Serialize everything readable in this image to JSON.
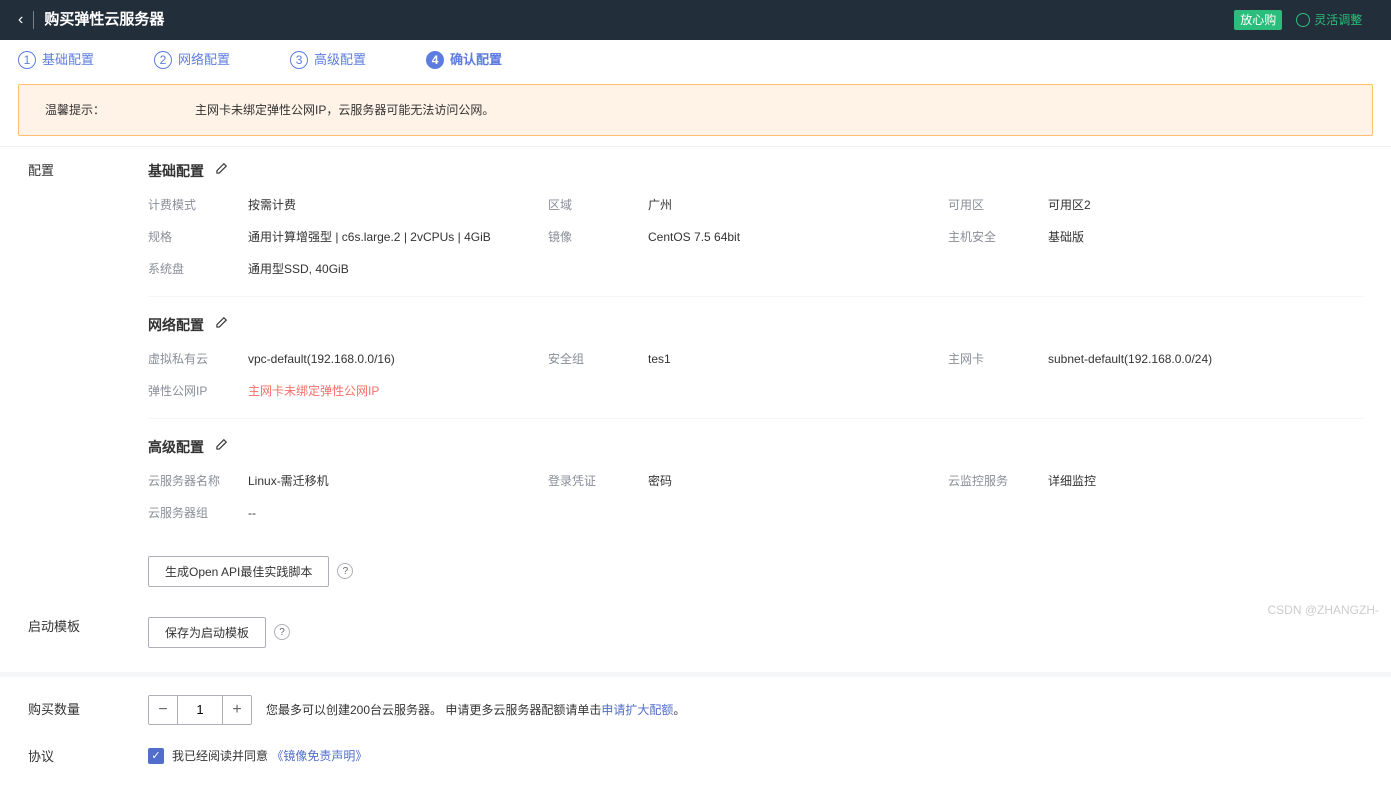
{
  "header": {
    "title": "购买弹性云服务器",
    "tag": "放心购",
    "adjust": "灵活调整"
  },
  "steps": {
    "s1": "基础配置",
    "s2": "网络配置",
    "s3": "高级配置",
    "s4": "确认配置"
  },
  "tip": {
    "label": "温馨提示：",
    "text": "主网卡未绑定弹性公网IP，云服务器可能无法访问公网。"
  },
  "side": {
    "config": "配置",
    "template": "启动模板",
    "quantity": "购买数量",
    "agreement": "协议"
  },
  "basic": {
    "title": "基础配置",
    "l1": "计费模式",
    "v1": "按需计费",
    "l2": "区域",
    "v2": "广州",
    "l3": "可用区",
    "v3": "可用区2",
    "l4": "规格",
    "v4": "通用计算增强型 | c6s.large.2 | 2vCPUs | 4GiB",
    "l5": "镜像",
    "v5": "CentOS 7.5 64bit",
    "l6": "主机安全",
    "v6": "基础版",
    "l7": "系统盘",
    "v7": "通用型SSD, 40GiB"
  },
  "net": {
    "title": "网络配置",
    "l1": "虚拟私有云",
    "v1": "vpc-default(192.168.0.0/16)",
    "l2": "安全组",
    "v2": "tes1",
    "l3": "主网卡",
    "v3": "subnet-default(192.168.0.0/24)",
    "l4": "弹性公网IP",
    "v4": "主网卡未绑定弹性公网IP"
  },
  "adv": {
    "title": "高级配置",
    "l1": "云服务器名称",
    "v1": "Linux-需迁移机",
    "l2": "登录凭证",
    "v2": "密码",
    "l3": "云监控服务",
    "v3": "详细监控",
    "l4": "云服务器组",
    "v4": "--"
  },
  "buttons": {
    "openapi": "生成Open API最佳实践脚本",
    "saveTemplate": "保存为启动模板"
  },
  "quantity": {
    "value": "1",
    "hint_a": "您最多可以创建200台云服务器。 申请更多云服务器配额请单击",
    "hint_link": "申请扩大配额",
    "hint_b": "。"
  },
  "agree": {
    "text": "我已经阅读并同意",
    "link": "《镜像免责声明》"
  },
  "watermark": "CSDN @ZHANGZH-"
}
